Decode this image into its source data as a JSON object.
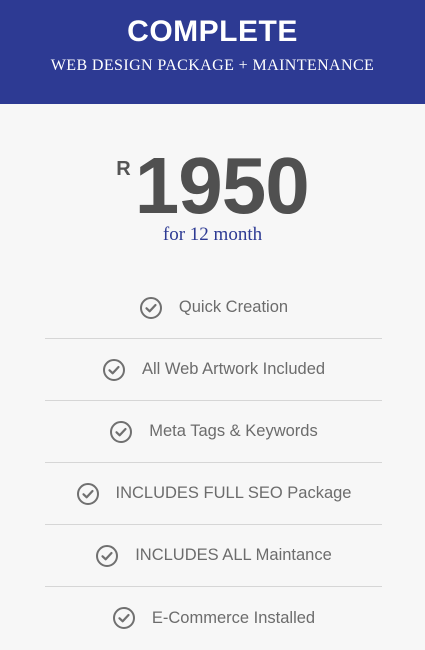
{
  "header": {
    "title": "COMPLETE",
    "subtitle": "WEB DESIGN PACKAGE + MAINTENANCE"
  },
  "price": {
    "currency": "R",
    "amount": "1950",
    "period": "for 12 month"
  },
  "features": [
    {
      "label": "Quick Creation",
      "icon": "check-circle-icon"
    },
    {
      "label": "All Web Artwork Included",
      "icon": "check-circle-icon"
    },
    {
      "label": "Meta Tags & Keywords",
      "icon": "check-circle-icon"
    },
    {
      "label": "INCLUDES FULL SEO Package",
      "icon": "check-circle-icon"
    },
    {
      "label": "INCLUDES ALL Maintance",
      "icon": "check-circle-icon"
    },
    {
      "label": "E-Commerce Installed",
      "icon": "check-circle-icon"
    }
  ],
  "colors": {
    "header_bg": "#2d3a93",
    "price_text": "#505050",
    "period_text": "#2d3a93",
    "feature_text": "#6c6c6c",
    "divider": "#d6d6d6",
    "card_bg": "#f7f7f7"
  }
}
